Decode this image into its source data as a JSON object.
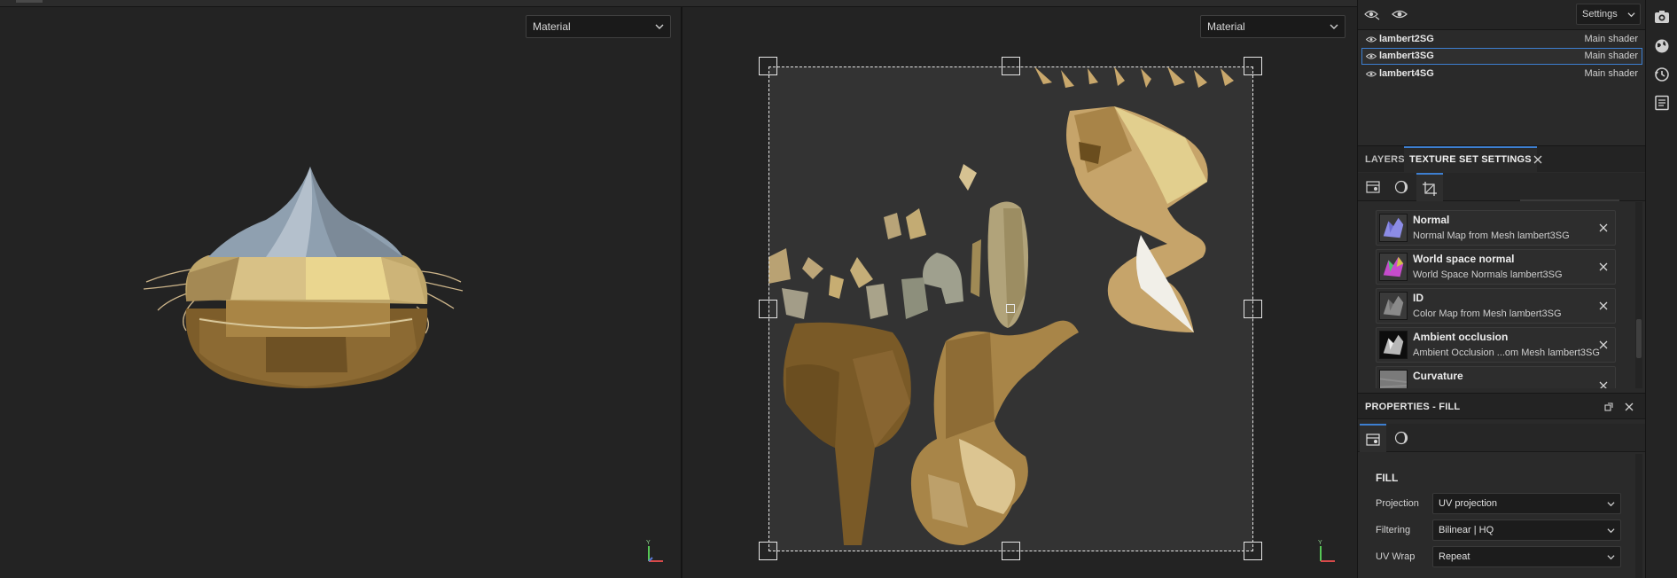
{
  "viewports": {
    "left_mode": "Material",
    "right_mode": "Material"
  },
  "axis": {
    "y_label": "Y"
  },
  "shaders": {
    "settings_label": "Settings",
    "items": [
      {
        "name": "lambert2SG",
        "tag": "Main shader",
        "selected": false
      },
      {
        "name": "lambert3SG",
        "tag": "Main shader",
        "selected": true
      },
      {
        "name": "lambert4SG",
        "tag": "Main shader",
        "selected": false
      }
    ]
  },
  "tabs": {
    "layers": "LAYERS",
    "texture_set_settings": "TEXTURE SET SETTINGS"
  },
  "bake_maps": [
    {
      "title": "Normal",
      "sub": "Normal Map from Mesh lambert3SG"
    },
    {
      "title": "World space normal",
      "sub": "World Space Normals lambert3SG"
    },
    {
      "title": "ID",
      "sub": "Color Map from Mesh lambert3SG"
    },
    {
      "title": "Ambient occlusion",
      "sub": "Ambient Occlusion ...om Mesh lambert3SG"
    },
    {
      "title": "Curvature",
      "sub": ""
    }
  ],
  "properties": {
    "title": "PROPERTIES - FILL",
    "section": "FILL",
    "rows": [
      {
        "label": "Projection",
        "value": "UV projection"
      },
      {
        "label": "Filtering",
        "value": "Bilinear | HQ"
      },
      {
        "label": "UV Wrap",
        "value": "Repeat"
      }
    ]
  },
  "icons": {
    "shader_bar": [
      "eye-link-icon",
      "eye-icon"
    ],
    "right_bar": [
      "camera-icon",
      "globe-icon",
      "history-icon",
      "log-icon"
    ]
  },
  "colors": {
    "accent": "#3d7fd1",
    "viewport_bg": "#232323",
    "panel_bg": "#2a2a2a"
  }
}
